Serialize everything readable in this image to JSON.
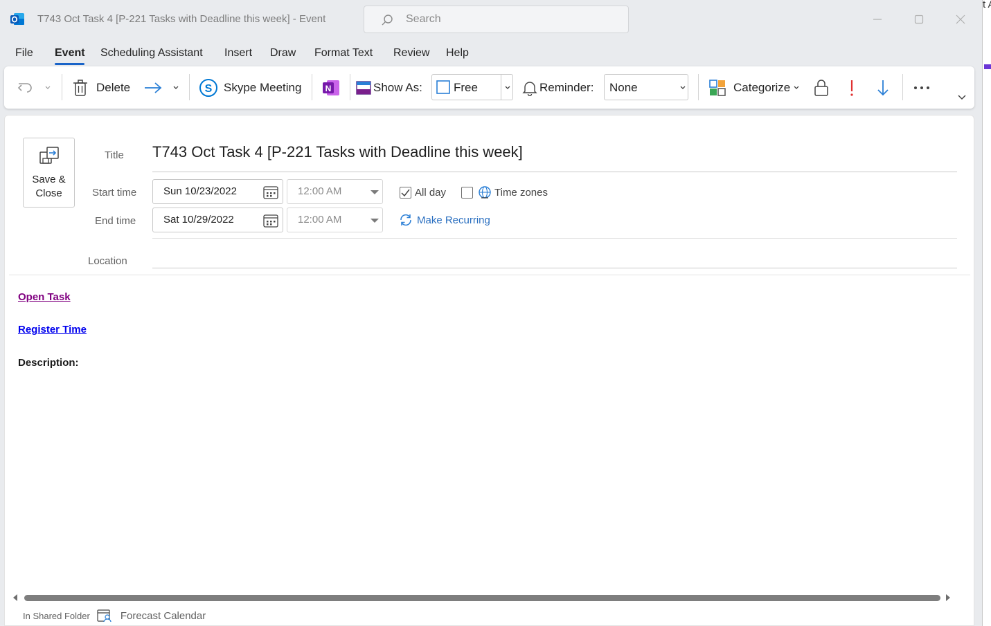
{
  "window": {
    "title": "T743 Oct Task 4 [P-221 Tasks with Deadline this week]  -  Event",
    "search_placeholder": "Search",
    "right_strip_text": "t A"
  },
  "menu": {
    "items": [
      "File",
      "Event",
      "Scheduling Assistant",
      "Insert",
      "Draw",
      "Format Text",
      "Review",
      "Help"
    ],
    "active": "Event"
  },
  "ribbon": {
    "delete_label": "Delete",
    "skype_label": "Skype Meeting",
    "show_as_label": "Show As:",
    "show_as_value": "Free",
    "reminder_label": "Reminder:",
    "reminder_value": "None",
    "categorize_label": "Categorize"
  },
  "form": {
    "save_close_label": "Save & Close",
    "title_label": "Title",
    "title_value": "T743 Oct Task 4 [P-221 Tasks with Deadline this week]",
    "start_label": "Start time",
    "start_date": "Sun 10/23/2022",
    "start_time": "12:00 AM",
    "end_label": "End time",
    "end_date": "Sat 10/29/2022",
    "end_time": "12:00 AM",
    "all_day_label": "All day",
    "all_day_checked": true,
    "time_zones_label": "Time zones",
    "time_zones_checked": false,
    "make_recurring_label": "Make Recurring",
    "location_label": "Location",
    "location_value": ""
  },
  "body": {
    "open_task_link": "Open Task",
    "register_time_link": "Register Time",
    "description_label": "Description:"
  },
  "status": {
    "folder_label": "In Shared Folder",
    "folder_name": "Forecast Calendar"
  },
  "colors": {
    "accent": "#1a64c8",
    "visited_link": "#800080",
    "link": "#0000ee",
    "importance_high": "#e03131",
    "importance_low": "#2a7fd6"
  }
}
